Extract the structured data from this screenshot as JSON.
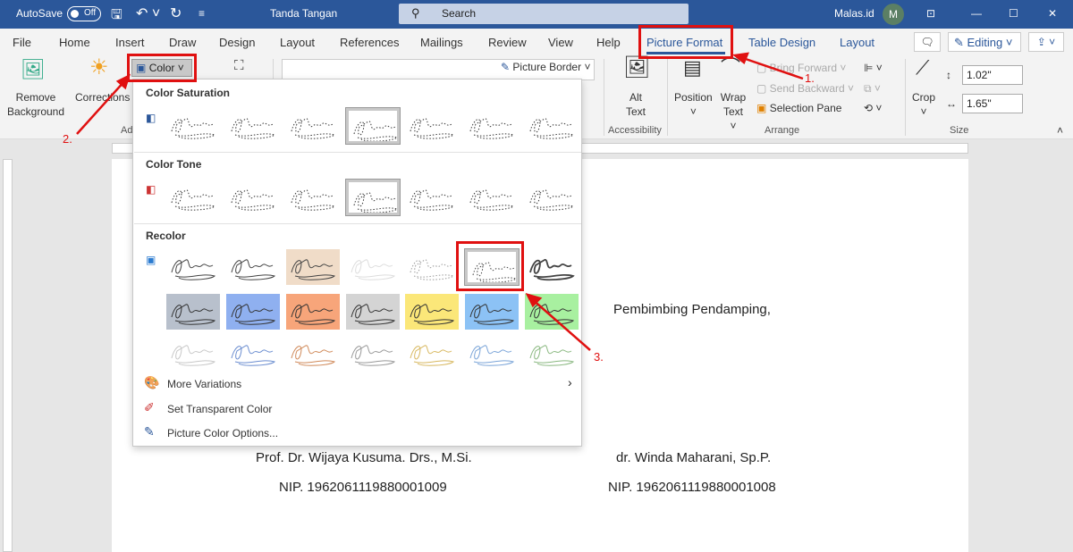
{
  "titlebar": {
    "autosave_label": "AutoSave",
    "autosave_state": "Off",
    "doc_title": "Tanda Tangan",
    "search_placeholder": "Search",
    "user": "Malas.id",
    "avatar_initial": "M"
  },
  "tabs": [
    "File",
    "Home",
    "Insert",
    "Draw",
    "Design",
    "Layout",
    "References",
    "Mailings",
    "Review",
    "View",
    "Help",
    "Picture Format",
    "Table Design",
    "Layout"
  ],
  "active_tab": "Picture Format",
  "editing_label": "Editing",
  "ribbon": {
    "remove_background": [
      "Remove",
      "Background"
    ],
    "corrections": "Corrections",
    "color": "Color",
    "picture_border": "Picture Border",
    "alt_text": [
      "Alt",
      "Text"
    ],
    "position": "Position",
    "wrap_text": [
      "Wrap",
      "Text"
    ],
    "bring_forward": "Bring Forward",
    "send_backward": "Send Backward",
    "selection_pane": "Selection Pane",
    "crop": "Crop",
    "height": "1.02\"",
    "width": "1.65\"",
    "groups": {
      "adjust": "Ad",
      "accessibility": "Accessibility",
      "arrange": "Arrange",
      "size": "Size"
    }
  },
  "color_menu": {
    "sections": [
      {
        "title": "Color Saturation"
      },
      {
        "title": "Color Tone"
      },
      {
        "title": "Recolor"
      }
    ],
    "recolor_row2_colors": [
      "#b8c0cc",
      "#8fb0f0",
      "#f7a57a",
      "#d4d4d4",
      "#fbe779",
      "#8cc2f5",
      "#a8f0a0"
    ],
    "recolor_row3_colors": [
      "#c8c8c8",
      "#6c8ed0",
      "#d08a5a",
      "#999999",
      "#d8b860",
      "#7aa4d8",
      "#8ab880"
    ],
    "items": [
      {
        "label": "More Variations",
        "icon": "palette-icon"
      },
      {
        "label": "Set Transparent Color",
        "icon": "eyedropper-icon"
      },
      {
        "label": "Picture Color Options...",
        "icon": "paint-icon"
      }
    ]
  },
  "document": {
    "colon": ":",
    "right_role": "Pembimbing Pendamping,",
    "left_name": "Prof. Dr. Wijaya Kusuma. Drs., M.Si.",
    "right_name": "dr. Winda Maharani, Sp.P.",
    "left_nip": "NIP. 1962061119880001009",
    "right_nip": "NIP. 1962061119880001008"
  },
  "annotations": [
    "1.",
    "2.",
    "3."
  ],
  "colors": {
    "title_bar": "#2b579a",
    "annotation": "#e01010"
  }
}
